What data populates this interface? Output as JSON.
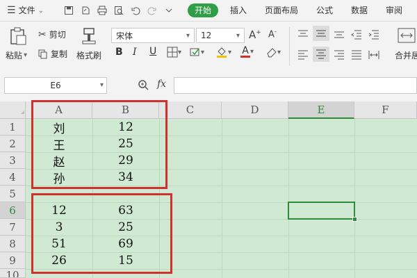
{
  "topbar": {
    "file_menu": "文件",
    "tabs": [
      "开始",
      "插入",
      "页面布局",
      "公式",
      "数据",
      "审阅"
    ],
    "active_tab": "开始"
  },
  "ribbon": {
    "paste": "粘贴",
    "cut": "剪切",
    "copy": "复制",
    "format_painter": "格式刷",
    "font_name": "宋体",
    "font_size": "12",
    "merge_center": "合并居"
  },
  "formula_bar": {
    "name_box": "E6",
    "fx_label": "fx",
    "formula": ""
  },
  "grid": {
    "columns": [
      "A",
      "B",
      "C",
      "D",
      "E",
      "F"
    ],
    "active_column": "E",
    "rows": [
      "1",
      "2",
      "3",
      "4",
      "5",
      "6",
      "7",
      "8",
      "9",
      "10"
    ],
    "active_row": "6",
    "cells_top": [
      [
        "刘",
        "12"
      ],
      [
        "王",
        "25"
      ],
      [
        "赵",
        "29"
      ],
      [
        "孙",
        "34"
      ]
    ],
    "cells_bottom": [
      [
        "12",
        "63"
      ],
      [
        "3",
        "25"
      ],
      [
        "51",
        "69"
      ],
      [
        "26",
        "15"
      ]
    ]
  },
  "colors": {
    "accent_green": "#2f9e44",
    "grid_bg": "#cfe9d2",
    "highlight_red": "#d0312d"
  }
}
